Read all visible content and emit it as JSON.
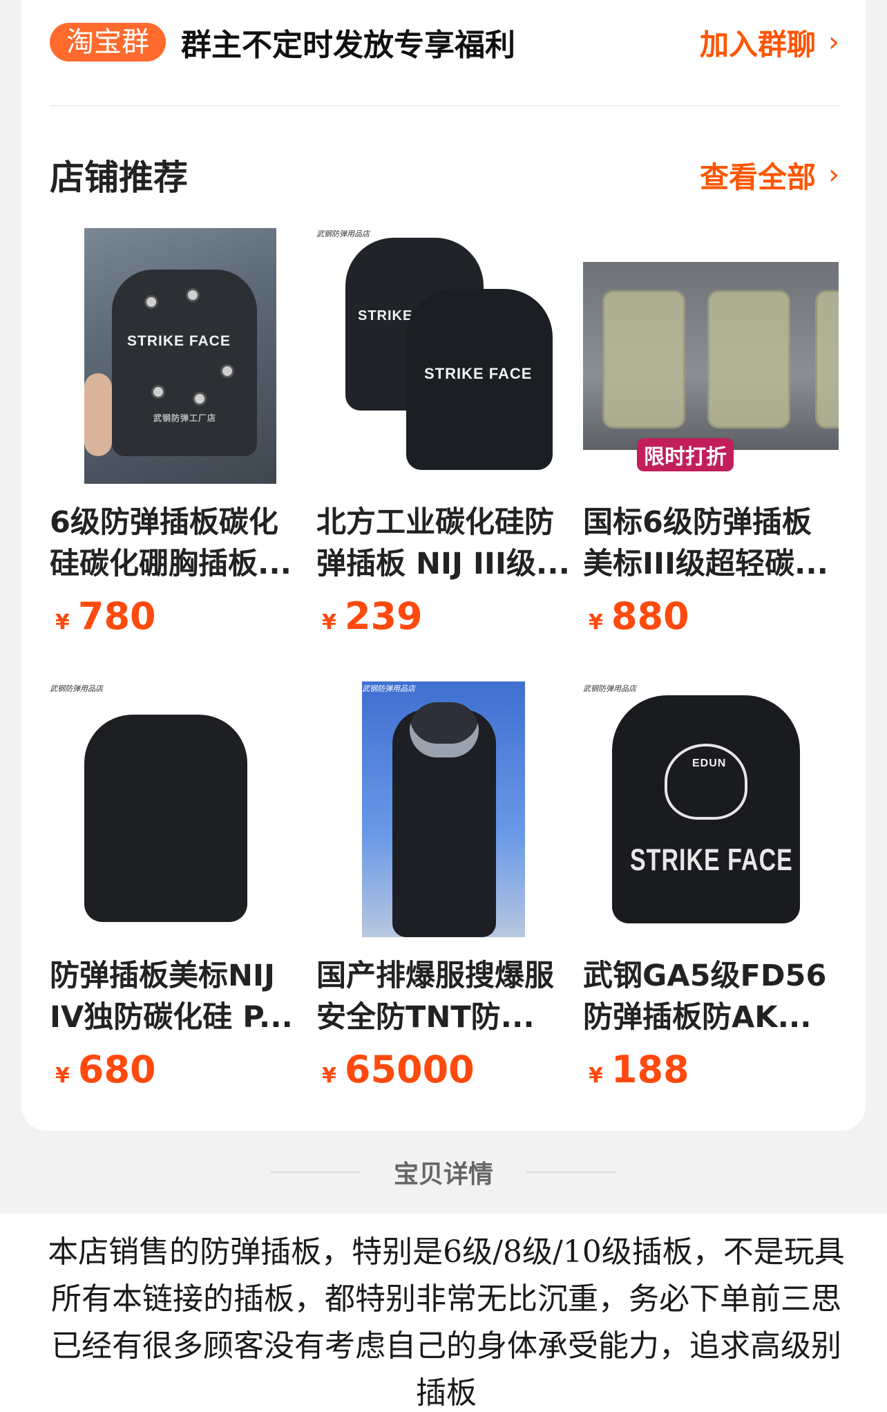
{
  "group": {
    "badge": "淘宝群",
    "text": "群主不定时发放专享福利",
    "join_label": "加入群聊",
    "chevron": "chevron-right-icon"
  },
  "recommend": {
    "title": "店铺推荐",
    "view_all": "查看全部",
    "chevron": "chevron-right-icon"
  },
  "products": [
    {
      "title": "6级防弹插板碳化硅碳化硼胸插板...",
      "currency": "¥",
      "price": "780",
      "image_text": "STRIKE FACE",
      "image_caption": "武钢防弹工厂店"
    },
    {
      "title": "北方工业碳化硅防弹插板 NIJ III级...",
      "currency": "¥",
      "price": "239",
      "image_tag": "武钢防弹用品店",
      "image_text_a": "STRIKE",
      "image_text_b": "STRIKE  FACE"
    },
    {
      "title": "国标6级防弹插板美标III级超轻碳...",
      "currency": "¥",
      "price": "880",
      "image_badge": "限时打折"
    },
    {
      "title": "防弹插板美标NIJ IV独防碳化硅 P...",
      "currency": "¥",
      "price": "680",
      "image_tag": "武钢防弹用品店"
    },
    {
      "title": "国产排爆服搜爆服安全防TNT防...",
      "currency": "¥",
      "price": "65000",
      "image_tag": "武钢防弹用品店"
    },
    {
      "title": "武钢GA5级FD56防弹插板防AK...",
      "currency": "¥",
      "price": "188",
      "image_tag": "武钢防弹用品店",
      "image_text": "STRIKE FACE",
      "emblem_text": "EDUN"
    }
  ],
  "details": {
    "label": "宝贝详情",
    "lines": [
      "本店销售的防弹插板，特别是6级/8级/10级插板，不是玩具",
      "所有本链接的插板，都特别非常无比沉重，务必下单前三思",
      "已经有很多顾客没有考虑自己的身体承受能力，追求高级别",
      "插板"
    ]
  },
  "colors": {
    "accent": "#ff5500",
    "price": "#ff4a0f",
    "badge": "#ff6a2d"
  }
}
